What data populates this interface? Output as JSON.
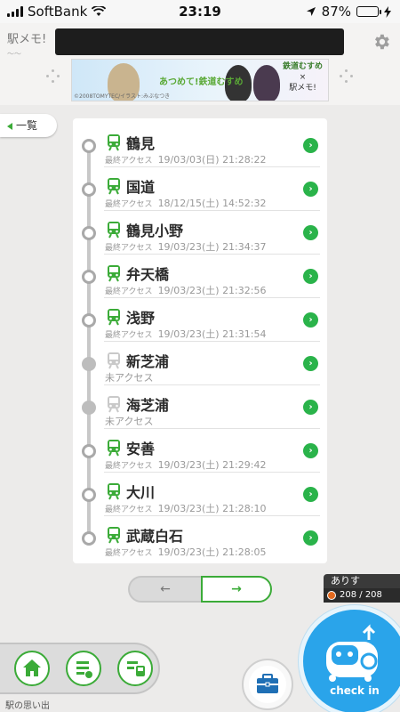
{
  "status_bar": {
    "carrier": "SoftBank",
    "time": "23:19",
    "battery": "87%",
    "battery_level": 0.87
  },
  "header": {
    "logo": "駅メモ!",
    "banner": {
      "title": "あつめて!鉄道むすめ",
      "brand_line1": "鉄道むすめ",
      "brand_x": "×",
      "brand_line2": "駅メモ!",
      "copyright": "©2008TOMYTEC/イラスト:みぶなつき"
    }
  },
  "back_tab": {
    "label": "一覧"
  },
  "list": {
    "access_label": "最終アクセス",
    "stations": [
      {
        "name": "鶴見",
        "accessed": true,
        "date": "19/03/03(日)",
        "time": "21:28:22"
      },
      {
        "name": "国道",
        "accessed": true,
        "date": "18/12/15(土)",
        "time": "14:52:32"
      },
      {
        "name": "鶴見小野",
        "accessed": true,
        "date": "19/03/23(土)",
        "time": "21:34:37"
      },
      {
        "name": "弁天橋",
        "accessed": true,
        "date": "19/03/23(土)",
        "time": "21:32:56"
      },
      {
        "name": "浅野",
        "accessed": true,
        "date": "19/03/23(土)",
        "time": "21:31:54"
      },
      {
        "name": "新芝浦",
        "accessed": false,
        "status": "未アクセス"
      },
      {
        "name": "海芝浦",
        "accessed": false,
        "status": "未アクセス"
      },
      {
        "name": "安善",
        "accessed": true,
        "date": "19/03/23(土)",
        "time": "21:29:42"
      },
      {
        "name": "大川",
        "accessed": true,
        "date": "19/03/23(土)",
        "time": "21:28:10"
      },
      {
        "name": "武蔵白石",
        "accessed": true,
        "date": "19/03/23(土)",
        "time": "21:28:05"
      }
    ]
  },
  "pager": {
    "prev": "←",
    "next": "→"
  },
  "user": {
    "name": "ありす",
    "count": "208 / 208"
  },
  "nav": {
    "caption": "駅の思い出"
  },
  "checkin": {
    "label": "check in"
  },
  "colors": {
    "green": "#3bab38",
    "blue": "#2aa4ea"
  }
}
